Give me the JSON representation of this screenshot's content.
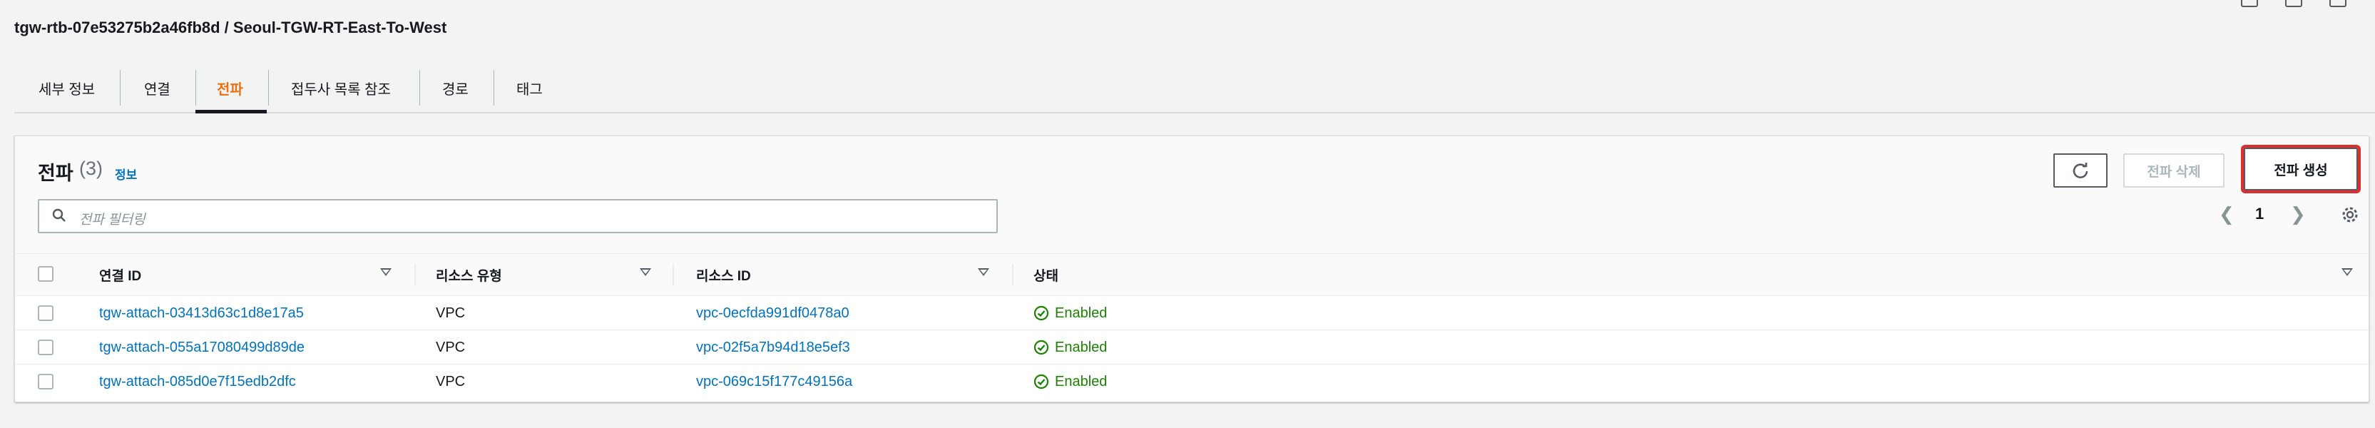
{
  "header": {
    "title": "tgw-rtb-07e53275b2a46fb8d / Seoul-TGW-RT-East-To-West"
  },
  "tabs": [
    {
      "label": "세부 정보",
      "active": false
    },
    {
      "label": "연결",
      "active": false
    },
    {
      "label": "전파",
      "active": true
    },
    {
      "label": "접두사 목록 참조",
      "active": false
    },
    {
      "label": "경로",
      "active": false
    },
    {
      "label": "태그",
      "active": false
    }
  ],
  "panel": {
    "title": "전파",
    "count": "(3)",
    "info": "정보",
    "delete_label": "전파 삭제",
    "create_label": "전파 생성",
    "search_placeholder": "전파 필터링",
    "page": "1",
    "columns": [
      "연결 ID",
      "리소스 유형",
      "리소스 ID",
      "상태"
    ],
    "rows": [
      {
        "attachment_id": "tgw-attach-03413d63c1d8e17a5",
        "resource_type": "VPC",
        "resource_id": "vpc-0ecfda991df0478a0",
        "status": "Enabled"
      },
      {
        "attachment_id": "tgw-attach-055a17080499d89de",
        "resource_type": "VPC",
        "resource_id": "vpc-02f5a7b94d18e5ef3",
        "status": "Enabled"
      },
      {
        "attachment_id": "tgw-attach-085d0e7f15edb2dfc",
        "resource_type": "VPC",
        "resource_id": "vpc-069c15f177c49156a",
        "status": "Enabled"
      }
    ]
  },
  "colors": {
    "accent": "#ec7211",
    "link": "#0073bb",
    "success": "#1d8102",
    "highlight": "#e02d2d"
  }
}
